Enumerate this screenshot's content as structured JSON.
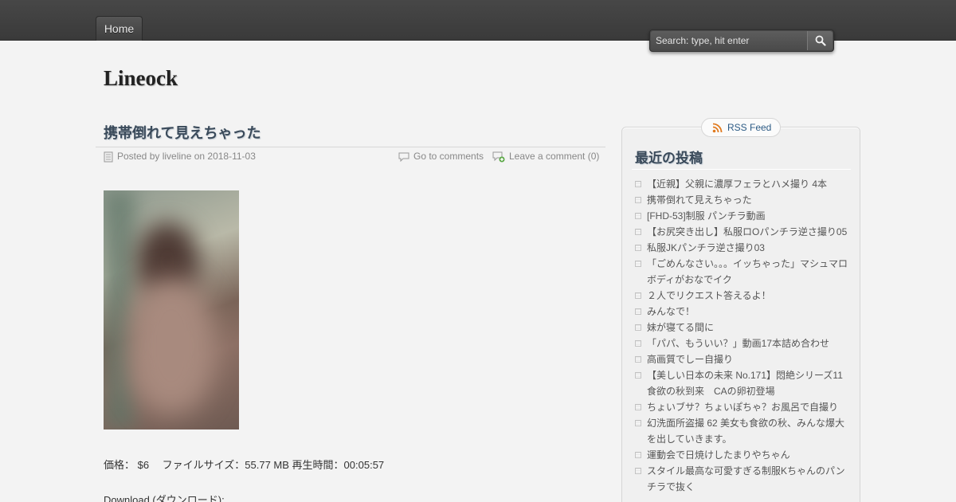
{
  "nav": {
    "home_label": "Home"
  },
  "search": {
    "placeholder": "Search: type, hit enter"
  },
  "site": {
    "title": "Lineock"
  },
  "post": {
    "title": "携帯倒れて見えちゃった",
    "posted_by": "Posted by liveline on 2018-11-03",
    "go_to_comments": "Go to comments",
    "leave_comment": "Leave a comment (0)",
    "info_line": "価格： $6　 ファイルサイズ：55.77 MB 再生時間：00:05:57",
    "download_label": "Download (ダウンロード):"
  },
  "sidebar": {
    "rss_label": "RSS Feed",
    "recent_title": "最近の投稿",
    "recent_posts": [
      "【近親】父親に濃厚フェラとハメ撮り 4本",
      "携帯倒れて見えちゃった",
      "[FHD-53]制服 パンチラ動画",
      "【お尻突き出し】私服ロOパンチラ逆さ撮り05",
      "私服JKパンチラ逆さ撮り03",
      "「ごめんなさい。。。イッちゃった」マシュマロボディがおなでイク",
      "２人でリクエスト答えるよ！",
      "みんなで！",
      "妹が寝てる間に",
      "「パパ、もういい？」動画17本詰め合わせ",
      "高画質でしー自撮り",
      "【美しい日本の未来 No.171】悶絶シリーズ11　食欲の秋到来　CAの卵初登場",
      "ちょいブサ？ちょいぽちゃ？お風呂で自撮り",
      "幻洗面所盗撮 62 美女も食欲の秋、みんな爆大を出していきます。",
      "運動会で日焼けしたまりやちゃん",
      "スタイル最高な可愛すぎる制服Kちゃんのパンチラで抜く"
    ]
  }
}
